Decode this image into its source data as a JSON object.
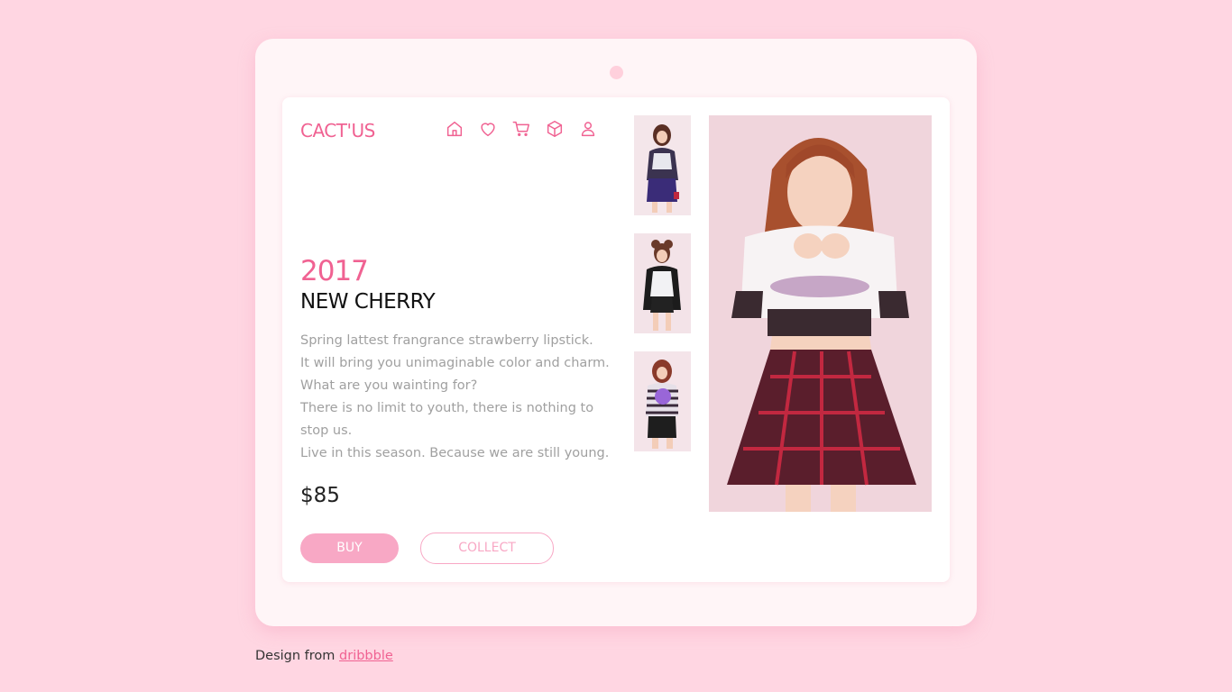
{
  "brand": {
    "logo": "CACT'US"
  },
  "nav": {
    "icons": [
      "home-icon",
      "heart-icon",
      "cart-icon",
      "box-icon",
      "user-icon"
    ]
  },
  "product": {
    "year": "2017",
    "name": "NEW CHERRY",
    "description": [
      "Spring lattest frangrance strawberry lipstick.",
      "It will bring you unimaginable color and charm.",
      "What are you wainting for?",
      "There is no limit to youth, there is nothing to",
      "stop us.",
      "Live in this season. Because we are still young."
    ],
    "price": "$85"
  },
  "actions": {
    "buy_label": "BUY",
    "collect_label": "COLLECT"
  },
  "footer": {
    "prefix": "Design from",
    "link_text": "dribbble"
  },
  "colors": {
    "background": "#ffd6e2",
    "accent": "#f06292",
    "button": "#f8a8c5"
  }
}
